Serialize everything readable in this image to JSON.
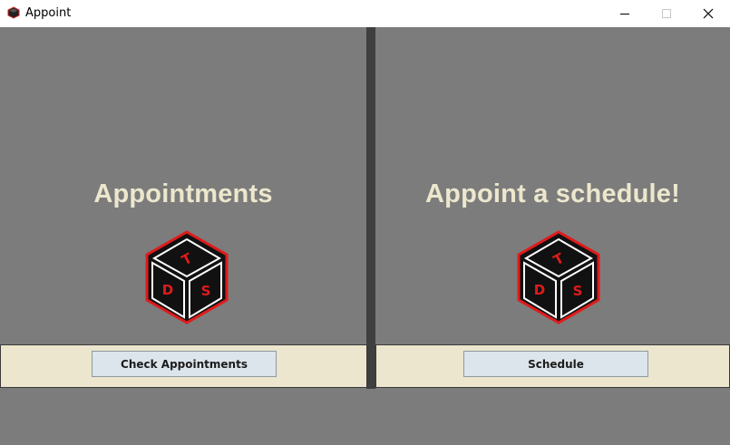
{
  "window": {
    "title": "Appoint",
    "controls": [
      "minimize",
      "maximize",
      "close"
    ]
  },
  "left_panel": {
    "heading": "Appointments",
    "button_label": "Check Appointments",
    "logo": {
      "letters": [
        "T",
        "D",
        "S"
      ]
    }
  },
  "right_panel": {
    "heading": "Appoint a schedule!",
    "button_label": "Schedule",
    "logo": {
      "letters": [
        "T",
        "D",
        "S"
      ]
    }
  },
  "colors": {
    "background": "#7c7c7c",
    "heading_text": "#ece7cd",
    "button_bar": "#ebe6cd",
    "button_face": "#dde5ec",
    "divider": "#3f3f3f",
    "logo_red": "#e01b1b"
  }
}
